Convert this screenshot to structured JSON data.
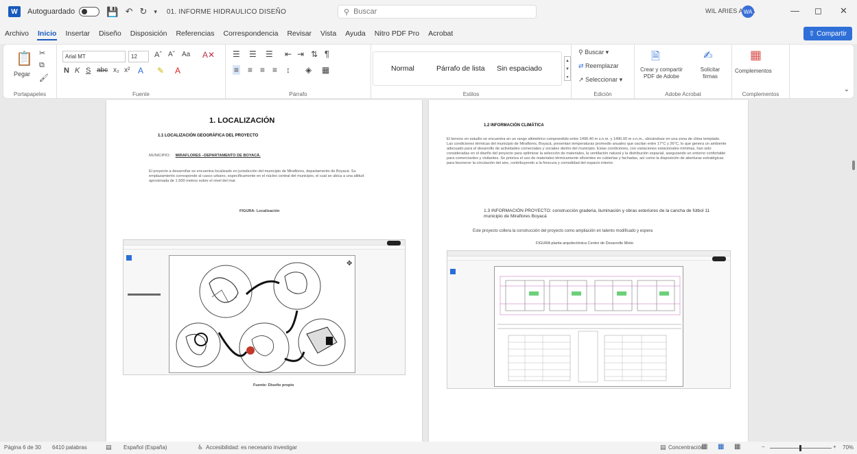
{
  "titlebar": {
    "autosave_label": "Autoguardado",
    "document_title": "01. INFORME HIDRAULICO DISEÑO",
    "search_placeholder": "Buscar",
    "user_name": "WIL ARIES ALBA",
    "user_initials": "WA"
  },
  "menu": {
    "tabs": [
      "Archivo",
      "Inicio",
      "Insertar",
      "Diseño",
      "Disposición",
      "Referencias",
      "Correspondencia",
      "Revisar",
      "Vista",
      "Ayuda",
      "Nitro PDF Pro",
      "Acrobat"
    ],
    "active_tab": "Inicio",
    "share_label": "Compartir"
  },
  "ribbon": {
    "clipboard": {
      "label": "Portapapeles",
      "paste": "Pegar"
    },
    "font": {
      "label": "Fuente",
      "font_name": "Arial MT",
      "font_size": "12",
      "bold": "N",
      "italic": "K",
      "underline": "S"
    },
    "paragraph": {
      "label": "Párrafo"
    },
    "styles": {
      "label": "Estilos",
      "items": [
        "Normal",
        "Párrafo de lista",
        "Sin espaciado"
      ]
    },
    "editing": {
      "label": "Edición",
      "find": "Buscar",
      "replace": "Reemplazar",
      "select": "Seleccionar"
    },
    "adobe": {
      "label": "Adobe Acrobat",
      "create_share": "Crear y compartir PDF de Adobe",
      "request_sign": "Solicitar firmas"
    },
    "addins": {
      "label": "Complementos",
      "button": "Complementos"
    }
  },
  "page1": {
    "heading": "1. LOCALIZACIÓN",
    "subheading": "1.1 LOCALIZACIÓN GEOGRÁFICA DEL PROYECTO",
    "municipio_label": "MUNICIPIO:",
    "municipio_value": "MIRAFLORES –DEPARTAMENTO DE BOYACÁ.",
    "paragraph": "El proyecto a desarrollar se encuentra localizado en jurisdicción del municipio de Miraflores, departamento de Boyacá. Su emplazamiento corresponde al casco urbano, específicamente en el núcleo central del municipio, el cual se ubica a una altitud aproximada de 1.500 metros sobre el nivel del mar.",
    "figure_caption": "FIGURA: Localización",
    "source": "Fuente: Diseño propio"
  },
  "page2": {
    "subheading": "1.2 INFORMACIÓN CLIMÁTICA",
    "paragraph": "El terreno en estudio se encuentra en un rango altimétrico comprendido entre 1490.40 m s.n.m. y 1490.00 m s.n.m., ubicándose en una zona de clima templado. Las condiciones térmicas del municipio de Miraflores, Boyacá, presentan temperaturas promedio anuales que oscilan entre 17°C y 26°C, lo que genera un ambiente adecuado para el desarrollo de actividades comerciales y sociales dentro del municipio. Estas condiciones, con variaciones estacionales mínimas, han sido consideradas en el diseño del proyecto para optimizar la selección de materiales, la ventilación natural y la distribución espacial, asegurando un entorno confortable para comerciantes y visitantes. Se prioriza el uso de materiales térmicamente eficientes en cubiertas y fachadas, así como la disposición de aberturas estratégicas para favorecer la circulación del aire, contribuyendo a la frescura y comodidad del espacio interior.",
    "section_heading": "1.3 INFORMACIÓN PROYECTO: construcción graderia, iluminación y obras exteriores de la cancha de fútbol 11 municipio de Miraflores Boyacá",
    "section_text": "Este proyecto collera la construcción del proyecto como ampliación en talento modificado y espera",
    "figure_caption": "FIGURA planta arquitectónica Centro de Desarrollo Mixto"
  },
  "statusbar": {
    "page": "Página 6 de 30",
    "words": "6410 palabras",
    "language": "Español (España)",
    "accessibility": "Accesibilidad: es necesario investigar",
    "focus": "Concentración",
    "zoom": "70%"
  },
  "colors": {
    "accent": "#185abd",
    "share": "#2f6fd8"
  }
}
